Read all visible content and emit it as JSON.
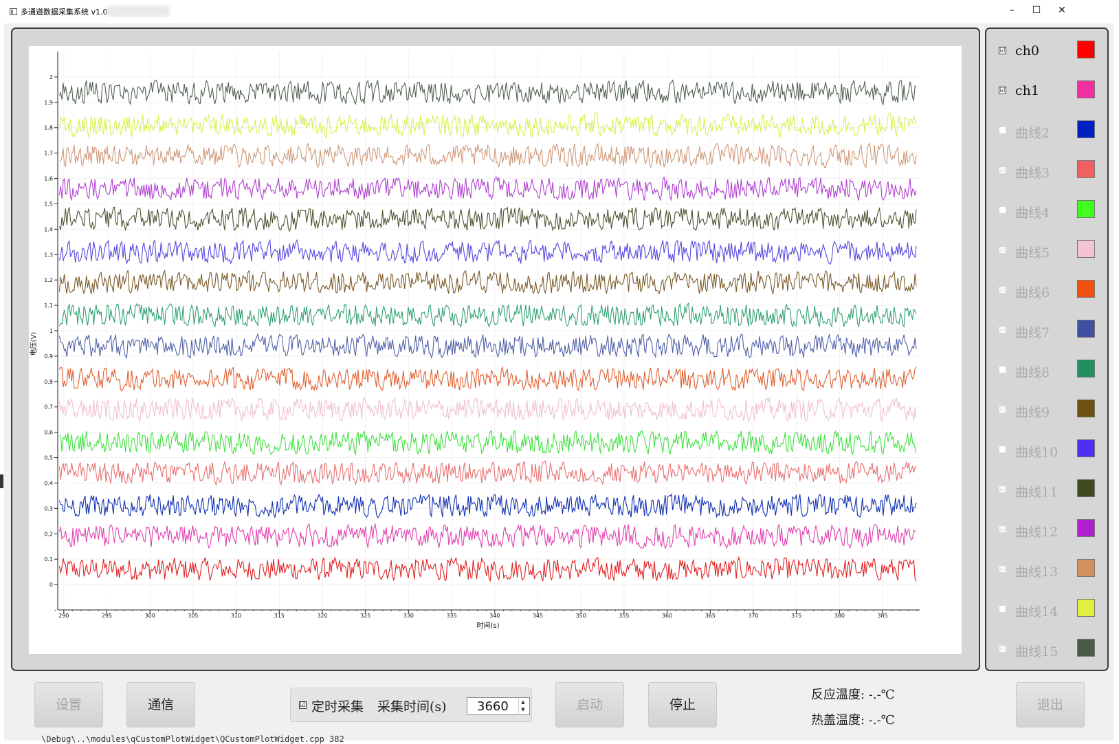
{
  "window": {
    "title": "多通道数据采集系统 v1.0.0 (",
    "minimize": "–",
    "maximize": "☐",
    "close": "✕"
  },
  "chart_data": {
    "type": "line",
    "xlabel": "时间(s)",
    "ylabel": "电压(V)",
    "xlim": [
      289.3,
      389.3
    ],
    "ylim": [
      -0.1,
      2.1
    ],
    "x_ticks": [
      290,
      295,
      300,
      305,
      310,
      315,
      320,
      325,
      330,
      335,
      340,
      345,
      350,
      355,
      360,
      365,
      370,
      375,
      380,
      385
    ],
    "y_ticks": [
      0,
      0.1,
      0.2,
      0.3,
      0.4,
      0.5,
      0.6,
      0.7,
      0.8,
      0.9,
      1,
      1.1,
      1.2,
      1.3,
      1.4,
      1.5,
      1.6,
      1.7,
      1.8,
      1.9,
      2
    ],
    "x_range": [
      289.5,
      388.9
    ],
    "series": [
      {
        "name": "ch0",
        "color": "#e02020",
        "center": 0.06,
        "amplitude": 0.05
      },
      {
        "name": "ch1",
        "color": "#e040b0",
        "center": 0.19,
        "amplitude": 0.05
      },
      {
        "name": "曲线2",
        "color": "#1030b0",
        "center": 0.31,
        "amplitude": 0.05
      },
      {
        "name": "曲线3",
        "color": "#e87070",
        "center": 0.44,
        "amplitude": 0.05
      },
      {
        "name": "曲线4",
        "color": "#40e040",
        "center": 0.56,
        "amplitude": 0.05
      },
      {
        "name": "曲线5",
        "color": "#f0c0d4",
        "center": 0.69,
        "amplitude": 0.05
      },
      {
        "name": "曲线6",
        "color": "#e06030",
        "center": 0.81,
        "amplitude": 0.05
      },
      {
        "name": "曲线7",
        "color": "#5060a8",
        "center": 0.94,
        "amplitude": 0.05
      },
      {
        "name": "曲线8",
        "color": "#30a070",
        "center": 1.06,
        "amplitude": 0.05
      },
      {
        "name": "曲线9",
        "color": "#7a5a28",
        "center": 1.19,
        "amplitude": 0.05
      },
      {
        "name": "曲线10",
        "color": "#5548e0",
        "center": 1.31,
        "amplitude": 0.05
      },
      {
        "name": "曲线11",
        "color": "#4e5030",
        "center": 1.44,
        "amplitude": 0.05
      },
      {
        "name": "曲线12",
        "color": "#b040d0",
        "center": 1.56,
        "amplitude": 0.05
      },
      {
        "name": "曲线13",
        "color": "#d09878",
        "center": 1.69,
        "amplitude": 0.05
      },
      {
        "name": "曲线14",
        "color": "#d8f050",
        "center": 1.81,
        "amplitude": 0.05
      },
      {
        "name": "曲线15",
        "color": "#506050",
        "center": 1.94,
        "amplitude": 0.05
      }
    ]
  },
  "legend": [
    {
      "label": "ch0",
      "color": "#ff0000",
      "checked": true,
      "enabled": true,
      "mark": "☑"
    },
    {
      "label": "ch1",
      "color": "#f030a0",
      "checked": true,
      "enabled": true,
      "mark": "☑"
    },
    {
      "label": "曲线2",
      "color": "#0020c0",
      "checked": false,
      "enabled": false,
      "mark": ""
    },
    {
      "label": "曲线3",
      "color": "#f06060",
      "checked": true,
      "enabled": false,
      "mark": "☑"
    },
    {
      "label": "曲线4",
      "color": "#40ff20",
      "checked": false,
      "enabled": false,
      "mark": ""
    },
    {
      "label": "曲线5",
      "color": "#f4c4d4",
      "checked": true,
      "enabled": false,
      "mark": "☑"
    },
    {
      "label": "曲线6",
      "color": "#f05010",
      "checked": true,
      "enabled": false,
      "mark": "☑"
    },
    {
      "label": "曲线7",
      "color": "#4050a0",
      "checked": true,
      "enabled": false,
      "mark": "☑"
    },
    {
      "label": "曲线8",
      "color": "#209060",
      "checked": false,
      "enabled": false,
      "mark": ""
    },
    {
      "label": "曲线9",
      "color": "#705010",
      "checked": true,
      "enabled": false,
      "mark": "☑"
    },
    {
      "label": "曲线10",
      "color": "#5030f0",
      "checked": false,
      "enabled": false,
      "mark": ""
    },
    {
      "label": "曲线11",
      "color": "#404c20",
      "checked": true,
      "enabled": false,
      "mark": "☑"
    },
    {
      "label": "曲线12",
      "color": "#b020d0",
      "checked": true,
      "enabled": false,
      "mark": "☑"
    },
    {
      "label": "曲线13",
      "color": "#d09060",
      "checked": true,
      "enabled": false,
      "mark": "☑"
    },
    {
      "label": "曲线14",
      "color": "#e0f040",
      "checked": false,
      "enabled": false,
      "mark": ""
    },
    {
      "label": "曲线15",
      "color": "#4c5c44",
      "checked": true,
      "enabled": false,
      "mark": "☑"
    }
  ],
  "controls": {
    "settings": "设置",
    "comm": "通信",
    "timer_checkbox": "☑",
    "timer_label": "定时采集",
    "time_label": "采集时间(s)",
    "time_value": "3660",
    "spin_up": "▲",
    "spin_down": "▼",
    "start": "启动",
    "stop": "停止",
    "exit": "退出"
  },
  "status": {
    "reaction_temp": "反应温度:  -.-℃",
    "lid_temp": "热盖温度:  -.-℃"
  },
  "statusbar": {
    "text": "\\Debug\\..\\modules\\qCustomPlotWidget\\QCustomPlotWidget.cpp 382"
  }
}
